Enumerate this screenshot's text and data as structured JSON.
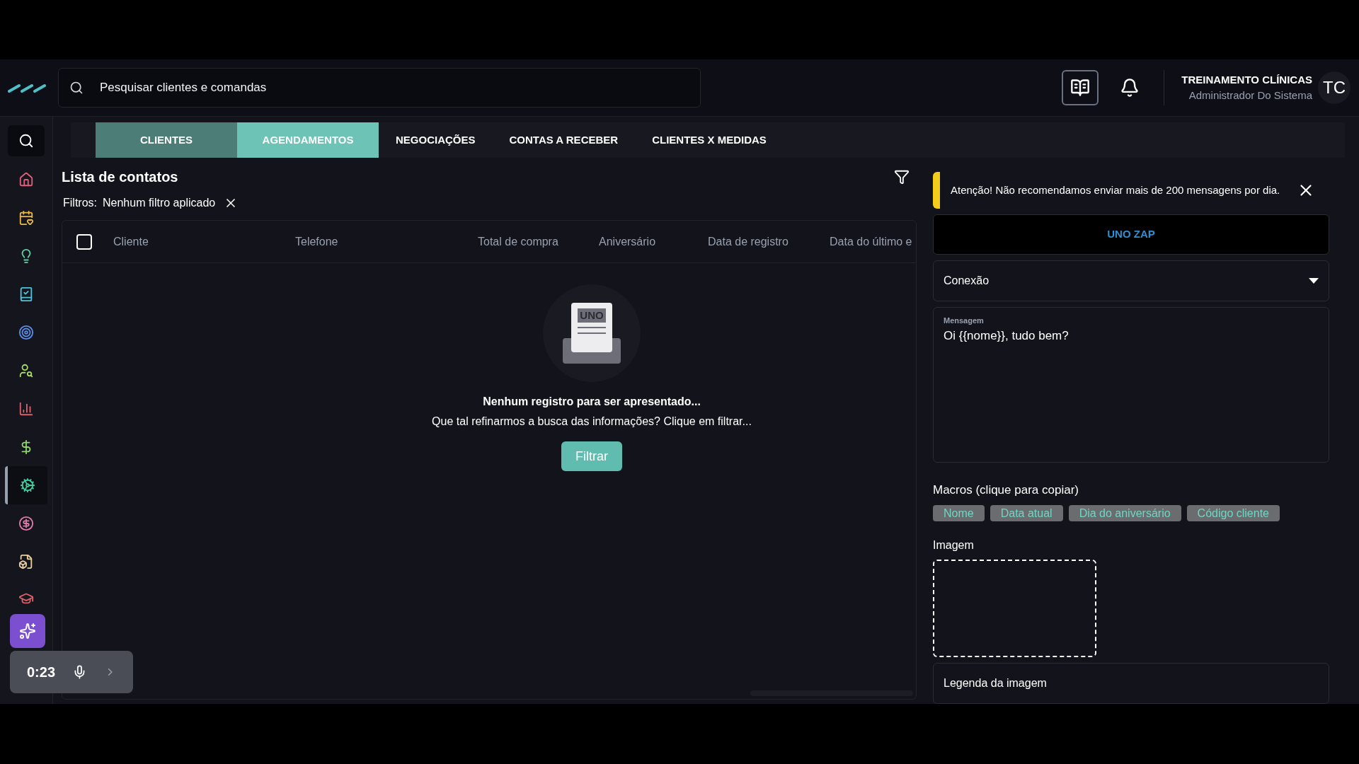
{
  "header": {
    "search": {
      "placeholder": "Pesquisar clientes e comandas"
    },
    "user": {
      "name": "TREINAMENTO CLÍNICAS",
      "role": "Administrador Do Sistema",
      "initials": "TC"
    }
  },
  "sidebar": {
    "items": [
      {
        "kind": "home",
        "color": "#e0607a",
        "selected": false
      },
      {
        "kind": "calendar",
        "color": "#e8b84a",
        "selected": false
      },
      {
        "kind": "idea",
        "color": "#5fd0a0",
        "selected": false
      },
      {
        "kind": "checklist",
        "color": "#4fc3d8",
        "selected": false
      },
      {
        "kind": "target",
        "color": "#5b8de8",
        "selected": false
      },
      {
        "kind": "user-search",
        "color": "#a6d86a",
        "selected": false
      },
      {
        "kind": "chart",
        "color": "#e0606a",
        "selected": false
      },
      {
        "kind": "dollar",
        "color": "#8ed86a",
        "selected": false
      },
      {
        "kind": "settings",
        "color": "#3fcfa0",
        "selected": true
      },
      {
        "kind": "coin",
        "color": "#e07aa8",
        "selected": false
      },
      {
        "kind": "package",
        "color": "#e8d0a0",
        "selected": false
      },
      {
        "kind": "school",
        "color": "#e0606a",
        "selected": false
      }
    ]
  },
  "recorder": {
    "time": "0:23"
  },
  "tabs": [
    {
      "label": "CLIENTES",
      "selected": true,
      "hovered": false
    },
    {
      "label": "AGENDAMENTOS",
      "selected": false,
      "hovered": true
    },
    {
      "label": "NEGOCIAÇÕES",
      "selected": false,
      "hovered": false
    },
    {
      "label": "CONTAS A RECEBER",
      "selected": false,
      "hovered": false
    },
    {
      "label": "CLIENTES X MEDIDAS",
      "selected": false,
      "hovered": false
    }
  ],
  "list": {
    "title": "Lista de contatos",
    "filters_label": "Filtros:",
    "filters_value": "Nenhum filtro aplicado",
    "table": {
      "select_all": {
        "checked": false
      },
      "columns": [
        "Cliente",
        "Telefone",
        "Total de compra",
        "Aniversário",
        "Data de registro",
        "Data do último e"
      ]
    },
    "empty_state": {
      "illustration_label": "UNO",
      "title": "Nenhum registro para ser apresentado...",
      "message": "Que tal refinarmos a busca das informações? Clique em filtrar...",
      "button": "Filtrar"
    }
  },
  "panel": {
    "alert": "Atenção! Não recomendamos enviar mais de 200 mensagens por dia.",
    "service": "UNO ZAP",
    "connection": {
      "placeholder": "Conexão"
    },
    "message": {
      "label": "Mensagem",
      "value": "Oi {{nome}}, tudo bem?"
    },
    "macros_label": "Macros (clique para copiar)",
    "macros": [
      "Nome",
      "Data atual",
      "Dia do aniversário",
      "Código cliente"
    ],
    "image_label": "Imagem",
    "caption": {
      "placeholder": "Legenda da imagem"
    }
  }
}
